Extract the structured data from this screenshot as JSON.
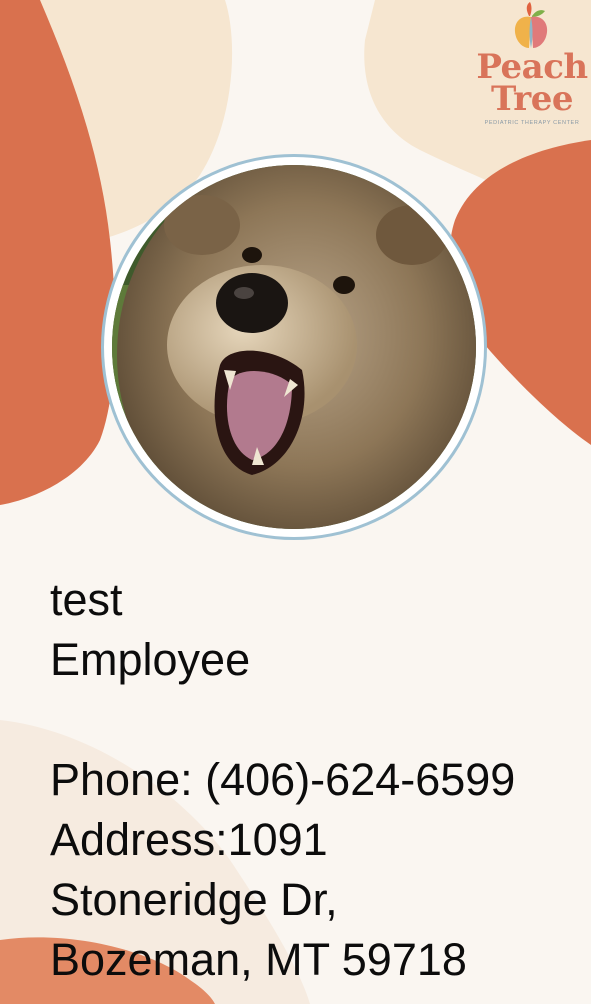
{
  "logo": {
    "name_line1": "Peach",
    "name_line2": "Tree",
    "tagline": "PEDIATRIC THERAPY CENTER"
  },
  "photo": {
    "subject": "bear-photo"
  },
  "employee": {
    "name": "test",
    "title": "Employee",
    "phone": "Phone: (406)-624-6599",
    "address_line1": "Address:1091",
    "address_line2": "Stoneridge Dr,",
    "address_line3": "Bozeman, MT 59718"
  },
  "colors": {
    "background": "#faf6f1",
    "accent_orange": "#d9714e",
    "soft_peach": "#f5e3cb",
    "photo_ring": "#9fc1d3",
    "logo_text": "#d9745a",
    "text": "#0c0c0c"
  }
}
